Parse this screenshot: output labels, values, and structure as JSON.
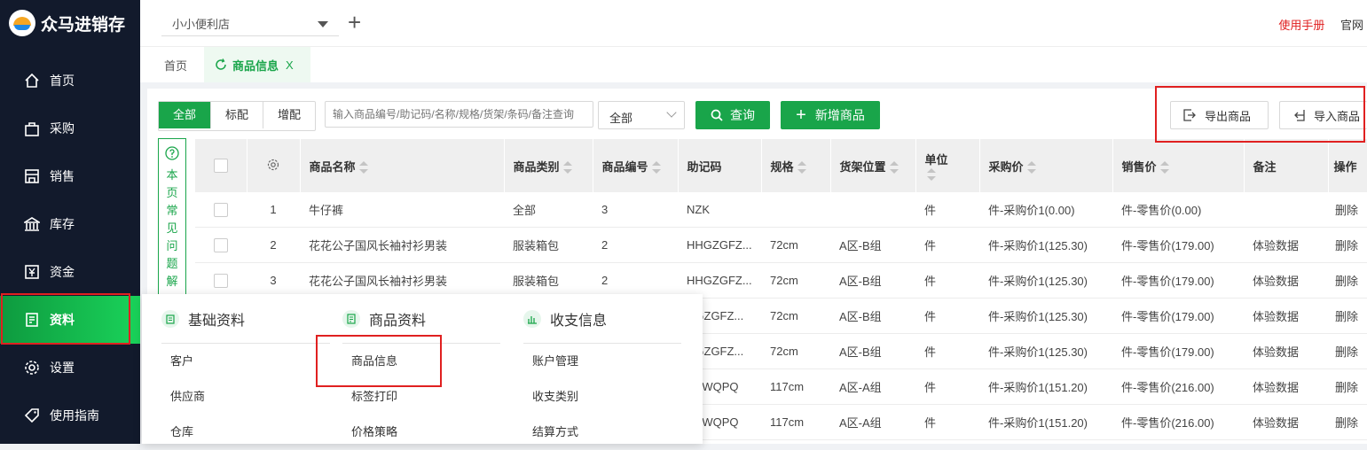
{
  "app": {
    "name": "众马进销存"
  },
  "sidebar": {
    "items": [
      {
        "label": "首页",
        "icon": "home-icon"
      },
      {
        "label": "采购",
        "icon": "bag-icon"
      },
      {
        "label": "销售",
        "icon": "store-icon"
      },
      {
        "label": "库存",
        "icon": "warehouse-icon"
      },
      {
        "label": "资金",
        "icon": "yen-icon"
      },
      {
        "label": "资料",
        "icon": "document-icon",
        "active": true
      },
      {
        "label": "设置",
        "icon": "gear-icon"
      },
      {
        "label": "使用指南",
        "icon": "tag-icon"
      }
    ]
  },
  "topbar": {
    "store": "小小便利店",
    "add_symbol": "+",
    "manual_link": "使用手册",
    "site_link": "官网"
  },
  "tabs": {
    "home": "首页",
    "active": "商品信息",
    "close": "X"
  },
  "toolbar": {
    "filters": [
      "全部",
      "标配",
      "增配"
    ],
    "search_placeholder": "输入商品编号/助记码/名称/规格/货架/条码/备注查询",
    "category_value": "全部",
    "query_button": "查询",
    "add_button": "新增商品",
    "export_button": "导出商品",
    "import_button": "导入商品"
  },
  "faq": {
    "text": "本页常见问题解"
  },
  "table": {
    "columns": [
      "商品名称",
      "商品类别",
      "商品编号",
      "助记码",
      "规格",
      "货架位置",
      "单位",
      "采购价",
      "销售价",
      "备注",
      "操作"
    ],
    "rows": [
      [
        "1",
        "牛仔裤",
        "全部",
        "3",
        "NZK",
        "",
        "",
        "件",
        "件-采购价1(0.00)",
        "件-零售价(0.00)",
        "",
        "删除"
      ],
      [
        "2",
        "花花公子国风长袖衬衫男装",
        "服装箱包",
        "2",
        "HHGZGFZ...",
        "72cm",
        "A区-B组",
        "件",
        "件-采购价1(125.30)",
        "件-零售价(179.00)",
        "体验数据",
        "删除"
      ],
      [
        "3",
        "花花公子国风长袖衬衫男装",
        "服装箱包",
        "2",
        "HHGZGFZ...",
        "72cm",
        "A区-B组",
        "件",
        "件-采购价1(125.30)",
        "件-零售价(179.00)",
        "体验数据",
        "删除"
      ],
      [
        "",
        "",
        "",
        "",
        "HGZGFZ...",
        "72cm",
        "A区-B组",
        "件",
        "件-采购价1(125.30)",
        "件-零售价(179.00)",
        "体验数据",
        "删除"
      ],
      [
        "",
        "",
        "",
        "",
        "HGZGFZ...",
        "72cm",
        "A区-B组",
        "件",
        "件-采购价1(125.30)",
        "件-零售价(179.00)",
        "体验数据",
        "删除"
      ],
      [
        "",
        "",
        "",
        "",
        "SYWQPQ",
        "117cm",
        "A区-A组",
        "件",
        "件-采购价1(151.20)",
        "件-零售价(216.00)",
        "体验数据",
        "删除"
      ],
      [
        "",
        "",
        "",
        "",
        "SYWQPQ",
        "117cm",
        "A区-A组",
        "件",
        "件-采购价1(151.20)",
        "件-零售价(216.00)",
        "体验数据",
        "删除"
      ]
    ]
  },
  "menu": {
    "columns": [
      {
        "title": "基础资料",
        "icon": "clipboard-icon",
        "items": [
          "客户",
          "供应商",
          "仓库"
        ]
      },
      {
        "title": "商品资料",
        "icon": "box-icon",
        "items": [
          "商品信息",
          "标签打印",
          "价格策略"
        ]
      },
      {
        "title": "收支信息",
        "icon": "bar-chart-icon",
        "items": [
          "账户管理",
          "收支类别",
          "结算方式"
        ]
      }
    ]
  },
  "colors": {
    "accent": "#19a54a",
    "sidebar": "#121a2c",
    "highlight_red": "#e02020"
  }
}
